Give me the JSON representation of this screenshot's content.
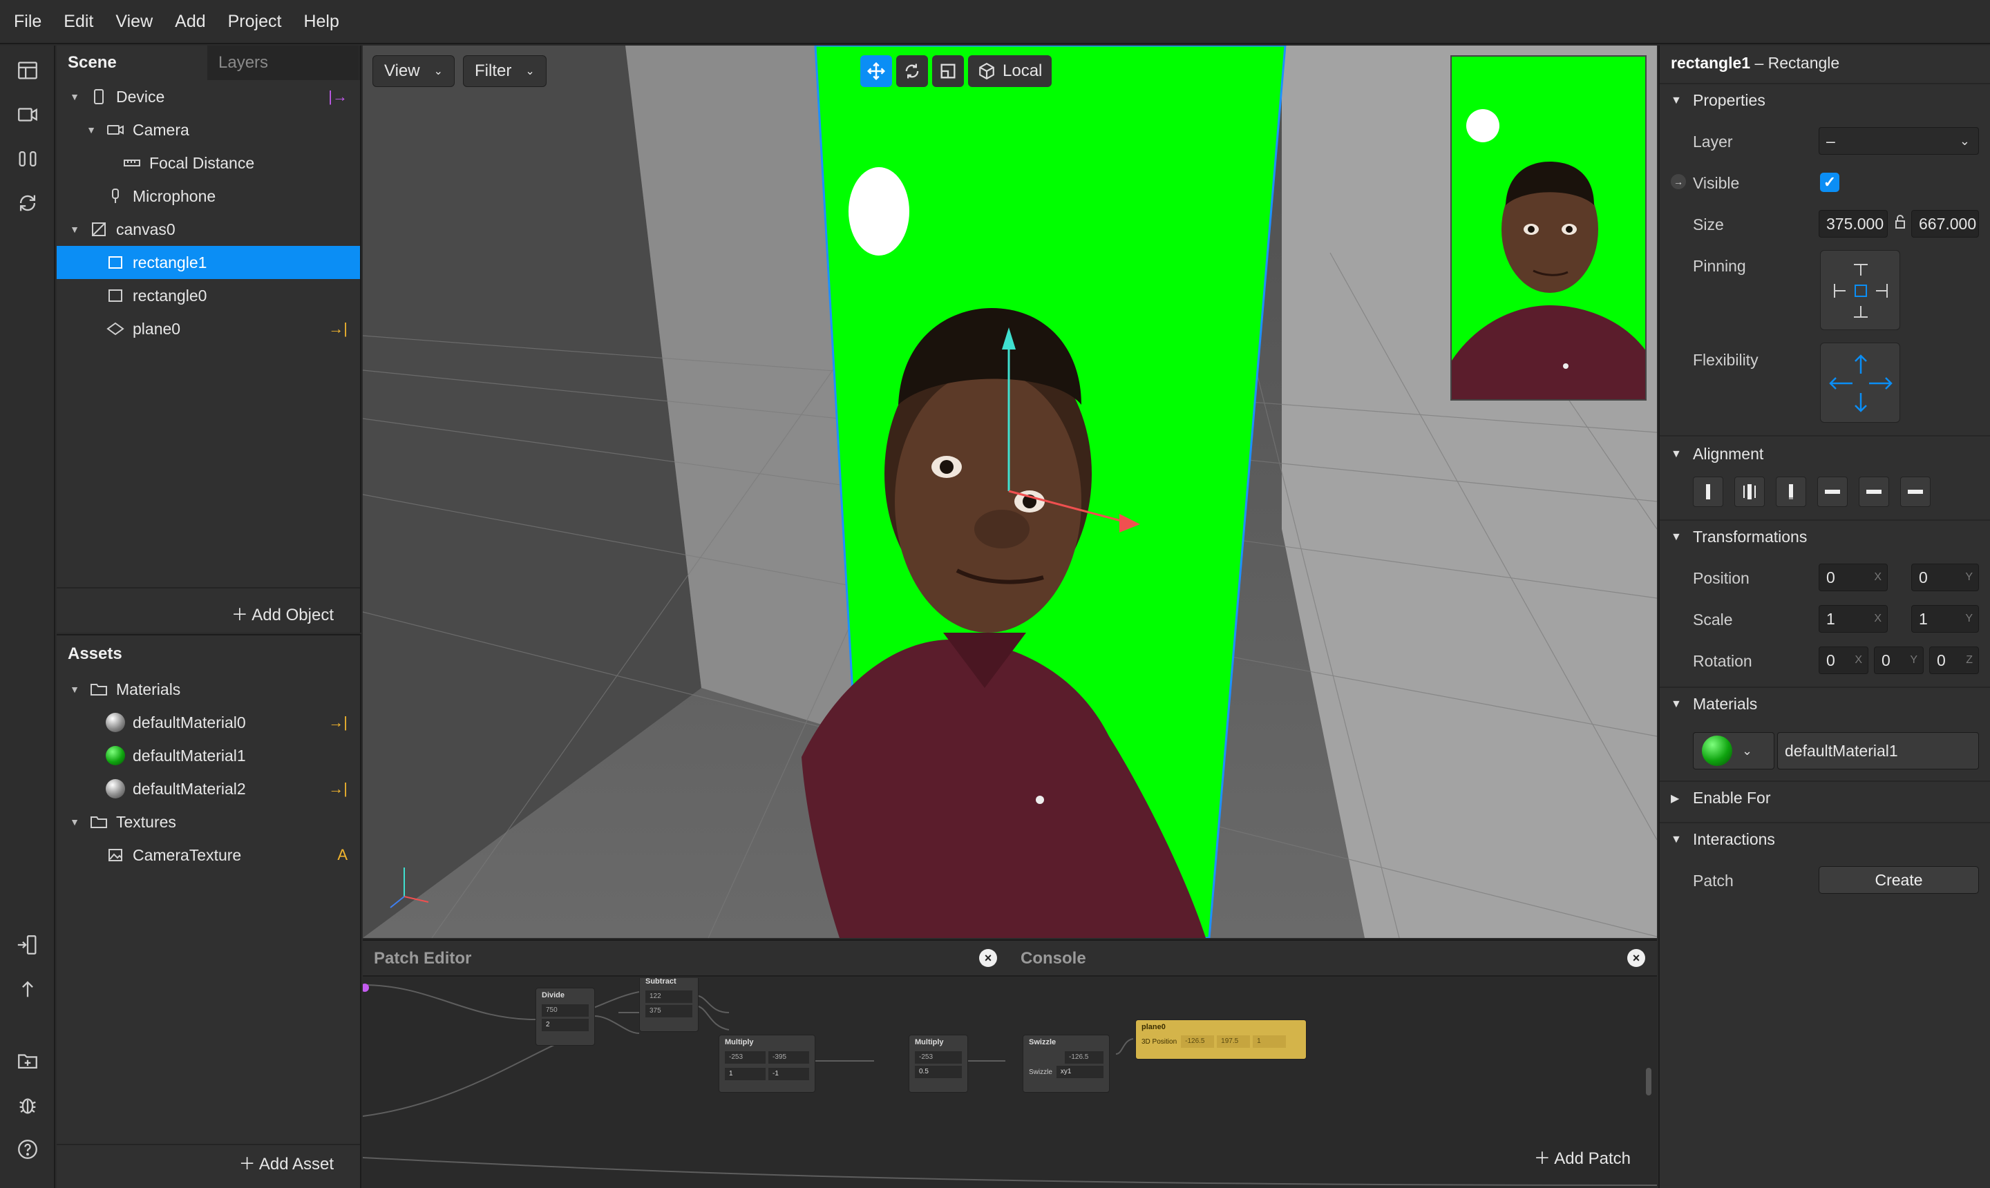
{
  "menu": [
    "File",
    "Edit",
    "View",
    "Add",
    "Project",
    "Help"
  ],
  "toolbar": {
    "icons": [
      "layout-icon",
      "video-icon",
      "split-view-icon",
      "refresh-icon",
      "send-to-device-icon",
      "upload-icon",
      "folder-import-icon",
      "bug-icon",
      "help-icon"
    ]
  },
  "scene": {
    "tabs": [
      "Scene",
      "Layers"
    ],
    "tree": [
      {
        "label": "Device",
        "icon": "device-icon",
        "badge": "|→"
      },
      {
        "label": "Camera",
        "icon": "camera-icon"
      },
      {
        "label": "Focal Distance",
        "icon": "ruler-icon"
      },
      {
        "label": "Microphone",
        "icon": "microphone-icon"
      },
      {
        "label": "canvas0",
        "icon": "canvas-icon"
      },
      {
        "label": "rectangle1",
        "icon": "rectangle-icon",
        "selected": true
      },
      {
        "label": "rectangle0",
        "icon": "rectangle-icon"
      },
      {
        "label": "plane0",
        "icon": "plane-icon",
        "badge": "→|"
      }
    ],
    "add_object": "Add Object"
  },
  "assets": {
    "title": "Assets",
    "tree": [
      {
        "label": "Materials",
        "icon": "folder-icon"
      },
      {
        "label": "defaultMaterial0",
        "icon": "material-sphere-icon",
        "badge": "→|"
      },
      {
        "label": "defaultMaterial1",
        "icon": "material-sphere-green-icon"
      },
      {
        "label": "defaultMaterial2",
        "icon": "material-sphere-icon",
        "badge": "→|"
      },
      {
        "label": "Textures",
        "icon": "folder-icon"
      },
      {
        "label": "CameraTexture",
        "icon": "image-icon",
        "badge": "A"
      }
    ],
    "add_asset": "Add Asset"
  },
  "viewport": {
    "view_label": "View",
    "filter_label": "Filter",
    "local_label": "Local",
    "canvas_color": "#00ff00",
    "selection_color": "#1e90ff"
  },
  "patch_editor": {
    "title": "Patch Editor",
    "console_title": "Console",
    "add_patch": "Add Patch",
    "nodes": {
      "divide": {
        "title": "Divide",
        "f1": "750",
        "f2": "2"
      },
      "subtract": {
        "title": "Subtract",
        "f1": "122",
        "f2": "375"
      },
      "multiply1": {
        "title": "Multiply",
        "f1": "-253",
        "f1b": "-395",
        "f2": "1",
        "f2b": "-1"
      },
      "multiply2": {
        "title": "Multiply",
        "f1": "-253",
        "f2": "0.5"
      },
      "swizzle": {
        "title": "Swizzle",
        "f1": "-126.5",
        "f2_label": "Swizzle",
        "f2": "xy1"
      },
      "plane": {
        "title": "plane0",
        "port": "3D Position",
        "x": "-126.5",
        "y": "197.5",
        "z": "1"
      }
    }
  },
  "inspector": {
    "title_name": "rectangle1",
    "title_type": " – Rectangle",
    "sections": {
      "properties": "Properties",
      "alignment": "Alignment",
      "transformations": "Transformations",
      "materials": "Materials",
      "enable_for": "Enable For",
      "interactions": "Interactions"
    },
    "layer_label": "Layer",
    "layer_value": "–",
    "visible_label": "Visible",
    "visible_checked": true,
    "size_label": "Size",
    "size_w": "375.000",
    "size_h": "667.000",
    "pinning_label": "Pinning",
    "flexibility_label": "Flexibility",
    "position_label": "Position",
    "position": {
      "x": "0",
      "y": "0"
    },
    "scale_label": "Scale",
    "scale": {
      "x": "1",
      "y": "1"
    },
    "rotation_label": "Rotation",
    "rotation": {
      "x": "0",
      "y": "0",
      "z": "0"
    },
    "material_value": "defaultMaterial1",
    "patch_label": "Patch",
    "create_label": "Create",
    "axis": {
      "x": "X",
      "y": "Y",
      "z": "Z"
    }
  }
}
